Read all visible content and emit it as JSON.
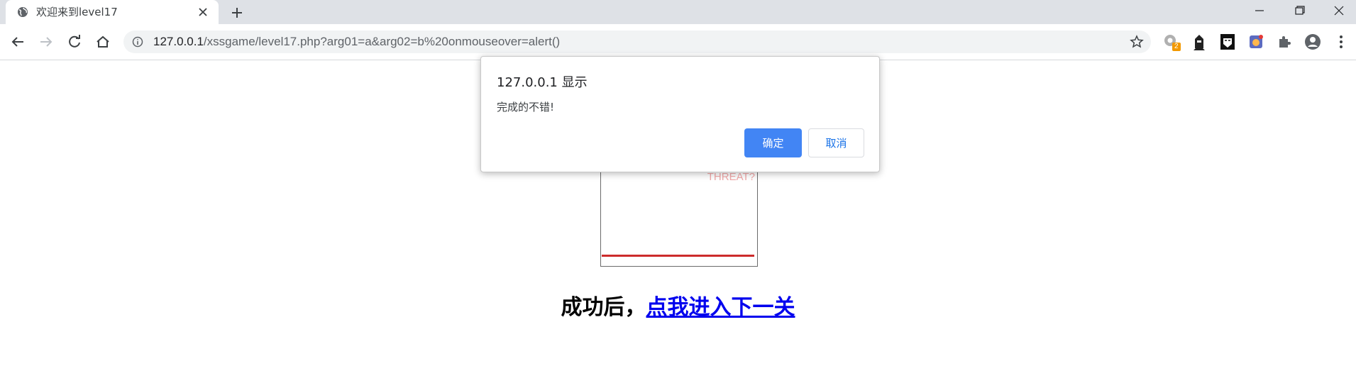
{
  "tab": {
    "title": "欢迎来到level17"
  },
  "address_bar": {
    "host": "127.0.0.1",
    "path": "/xssgame/level17.php?arg01=a&arg02=b%20onmouseover=alert()"
  },
  "extensions": {
    "badge_count": "2"
  },
  "page": {
    "threat_text": "THREAT?",
    "success_prefix": "成功后，",
    "next_level_link": "点我进入下一关"
  },
  "dialog": {
    "title": "127.0.0.1 显示",
    "message": "完成的不错!",
    "ok_label": "确定",
    "cancel_label": "取消"
  },
  "colors": {
    "dialog_ok": "#4285f4",
    "link": "#0000ee",
    "red_line": "#cc2b2b"
  }
}
